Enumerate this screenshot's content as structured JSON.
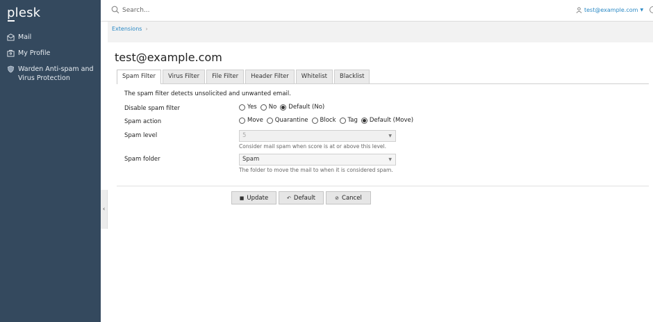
{
  "brand": {
    "logo": "plesk"
  },
  "sidebar": {
    "items": [
      {
        "label": "Mail",
        "icon": "envelope-icon"
      },
      {
        "label": "My Profile",
        "icon": "profile-card-icon"
      },
      {
        "label": "Warden Anti-spam and Virus Protection",
        "icon": "shield-icon"
      }
    ]
  },
  "topbar": {
    "search_placeholder": "Search...",
    "user_email": "test@example.com"
  },
  "breadcrumb": {
    "items": [
      "Extensions"
    ]
  },
  "main": {
    "title": "test@example.com",
    "tabs": [
      {
        "label": "Spam Filter",
        "active": true
      },
      {
        "label": "Virus Filter",
        "active": false
      },
      {
        "label": "File Filter",
        "active": false
      },
      {
        "label": "Header Filter",
        "active": false
      },
      {
        "label": "Whitelist",
        "active": false
      },
      {
        "label": "Blacklist",
        "active": false
      }
    ],
    "description": "The spam filter detects unsolicited and unwanted email.",
    "form": {
      "disable_spam_filter": {
        "label": "Disable spam filter",
        "options": [
          "Yes",
          "No",
          "Default (No)"
        ],
        "selected": "Default (No)"
      },
      "spam_action": {
        "label": "Spam action",
        "options": [
          "Move",
          "Quarantine",
          "Block",
          "Tag",
          "Default (Move)"
        ],
        "selected": "Default (Move)"
      },
      "spam_level": {
        "label": "Spam level",
        "value": "5",
        "hint": "Consider mail spam when score is at or above this level."
      },
      "spam_folder": {
        "label": "Spam folder",
        "value": "Spam",
        "hint": "The folder to move the mail to when it is considered spam."
      }
    },
    "buttons": {
      "update": "Update",
      "default": "Default",
      "cancel": "Cancel"
    }
  },
  "colors": {
    "sidebar_bg": "#34495e",
    "link": "#2a89c5"
  }
}
